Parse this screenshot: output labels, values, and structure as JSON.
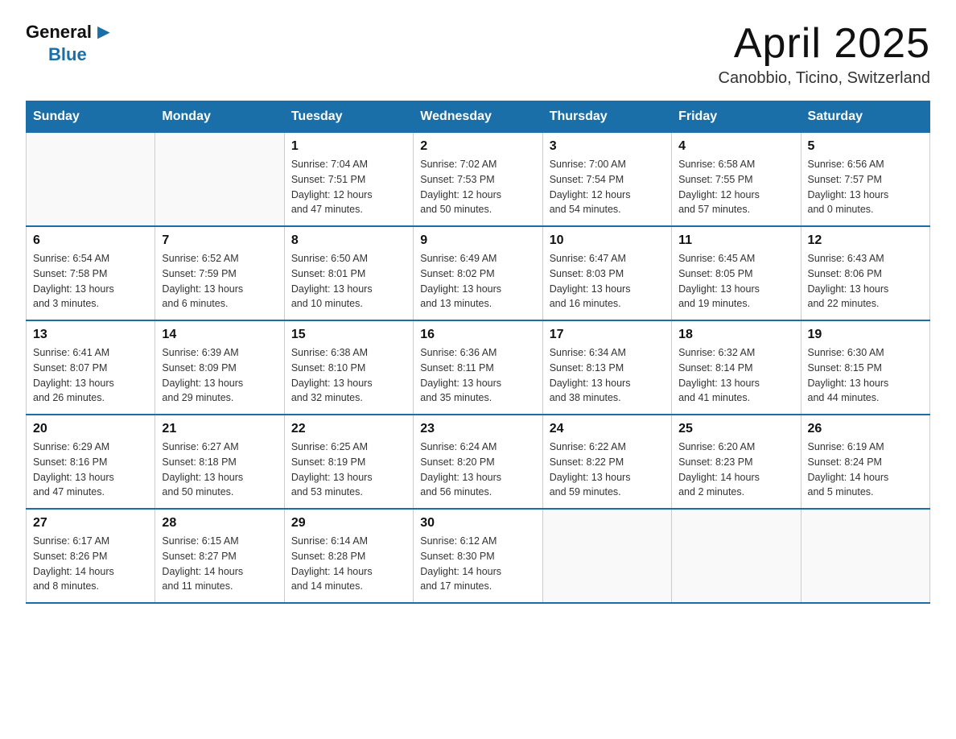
{
  "logo": {
    "general": "General",
    "arrow": "▶",
    "blue": "Blue"
  },
  "title": "April 2025",
  "subtitle": "Canobbio, Ticino, Switzerland",
  "weekdays": [
    "Sunday",
    "Monday",
    "Tuesday",
    "Wednesday",
    "Thursday",
    "Friday",
    "Saturday"
  ],
  "weeks": [
    [
      {
        "day": "",
        "info": ""
      },
      {
        "day": "",
        "info": ""
      },
      {
        "day": "1",
        "info": "Sunrise: 7:04 AM\nSunset: 7:51 PM\nDaylight: 12 hours\nand 47 minutes."
      },
      {
        "day": "2",
        "info": "Sunrise: 7:02 AM\nSunset: 7:53 PM\nDaylight: 12 hours\nand 50 minutes."
      },
      {
        "day": "3",
        "info": "Sunrise: 7:00 AM\nSunset: 7:54 PM\nDaylight: 12 hours\nand 54 minutes."
      },
      {
        "day": "4",
        "info": "Sunrise: 6:58 AM\nSunset: 7:55 PM\nDaylight: 12 hours\nand 57 minutes."
      },
      {
        "day": "5",
        "info": "Sunrise: 6:56 AM\nSunset: 7:57 PM\nDaylight: 13 hours\nand 0 minutes."
      }
    ],
    [
      {
        "day": "6",
        "info": "Sunrise: 6:54 AM\nSunset: 7:58 PM\nDaylight: 13 hours\nand 3 minutes."
      },
      {
        "day": "7",
        "info": "Sunrise: 6:52 AM\nSunset: 7:59 PM\nDaylight: 13 hours\nand 6 minutes."
      },
      {
        "day": "8",
        "info": "Sunrise: 6:50 AM\nSunset: 8:01 PM\nDaylight: 13 hours\nand 10 minutes."
      },
      {
        "day": "9",
        "info": "Sunrise: 6:49 AM\nSunset: 8:02 PM\nDaylight: 13 hours\nand 13 minutes."
      },
      {
        "day": "10",
        "info": "Sunrise: 6:47 AM\nSunset: 8:03 PM\nDaylight: 13 hours\nand 16 minutes."
      },
      {
        "day": "11",
        "info": "Sunrise: 6:45 AM\nSunset: 8:05 PM\nDaylight: 13 hours\nand 19 minutes."
      },
      {
        "day": "12",
        "info": "Sunrise: 6:43 AM\nSunset: 8:06 PM\nDaylight: 13 hours\nand 22 minutes."
      }
    ],
    [
      {
        "day": "13",
        "info": "Sunrise: 6:41 AM\nSunset: 8:07 PM\nDaylight: 13 hours\nand 26 minutes."
      },
      {
        "day": "14",
        "info": "Sunrise: 6:39 AM\nSunset: 8:09 PM\nDaylight: 13 hours\nand 29 minutes."
      },
      {
        "day": "15",
        "info": "Sunrise: 6:38 AM\nSunset: 8:10 PM\nDaylight: 13 hours\nand 32 minutes."
      },
      {
        "day": "16",
        "info": "Sunrise: 6:36 AM\nSunset: 8:11 PM\nDaylight: 13 hours\nand 35 minutes."
      },
      {
        "day": "17",
        "info": "Sunrise: 6:34 AM\nSunset: 8:13 PM\nDaylight: 13 hours\nand 38 minutes."
      },
      {
        "day": "18",
        "info": "Sunrise: 6:32 AM\nSunset: 8:14 PM\nDaylight: 13 hours\nand 41 minutes."
      },
      {
        "day": "19",
        "info": "Sunrise: 6:30 AM\nSunset: 8:15 PM\nDaylight: 13 hours\nand 44 minutes."
      }
    ],
    [
      {
        "day": "20",
        "info": "Sunrise: 6:29 AM\nSunset: 8:16 PM\nDaylight: 13 hours\nand 47 minutes."
      },
      {
        "day": "21",
        "info": "Sunrise: 6:27 AM\nSunset: 8:18 PM\nDaylight: 13 hours\nand 50 minutes."
      },
      {
        "day": "22",
        "info": "Sunrise: 6:25 AM\nSunset: 8:19 PM\nDaylight: 13 hours\nand 53 minutes."
      },
      {
        "day": "23",
        "info": "Sunrise: 6:24 AM\nSunset: 8:20 PM\nDaylight: 13 hours\nand 56 minutes."
      },
      {
        "day": "24",
        "info": "Sunrise: 6:22 AM\nSunset: 8:22 PM\nDaylight: 13 hours\nand 59 minutes."
      },
      {
        "day": "25",
        "info": "Sunrise: 6:20 AM\nSunset: 8:23 PM\nDaylight: 14 hours\nand 2 minutes."
      },
      {
        "day": "26",
        "info": "Sunrise: 6:19 AM\nSunset: 8:24 PM\nDaylight: 14 hours\nand 5 minutes."
      }
    ],
    [
      {
        "day": "27",
        "info": "Sunrise: 6:17 AM\nSunset: 8:26 PM\nDaylight: 14 hours\nand 8 minutes."
      },
      {
        "day": "28",
        "info": "Sunrise: 6:15 AM\nSunset: 8:27 PM\nDaylight: 14 hours\nand 11 minutes."
      },
      {
        "day": "29",
        "info": "Sunrise: 6:14 AM\nSunset: 8:28 PM\nDaylight: 14 hours\nand 14 minutes."
      },
      {
        "day": "30",
        "info": "Sunrise: 6:12 AM\nSunset: 8:30 PM\nDaylight: 14 hours\nand 17 minutes."
      },
      {
        "day": "",
        "info": ""
      },
      {
        "day": "",
        "info": ""
      },
      {
        "day": "",
        "info": ""
      }
    ]
  ]
}
